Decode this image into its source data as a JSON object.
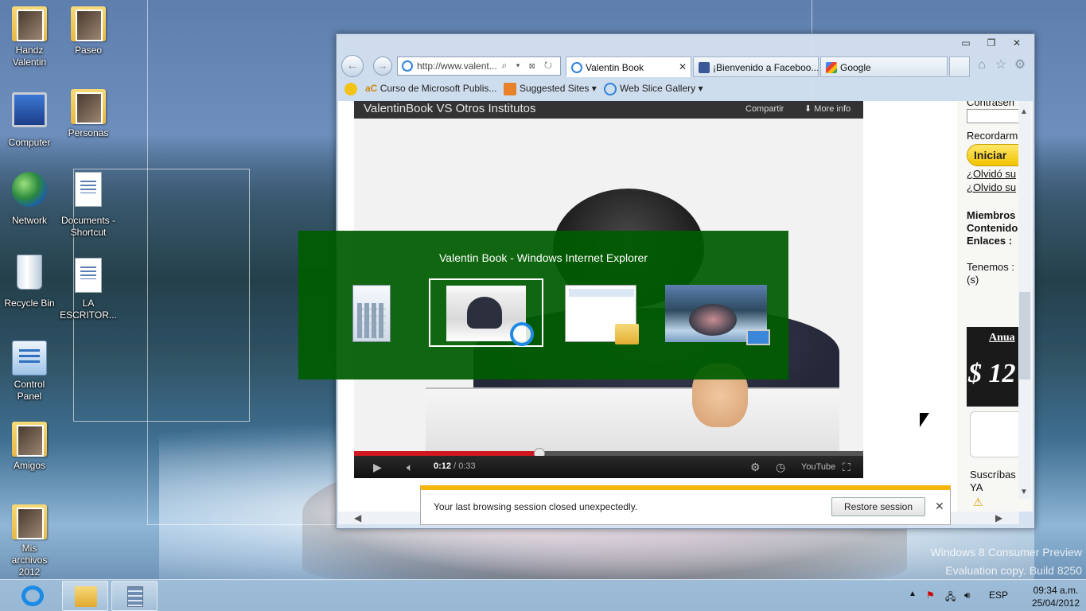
{
  "desktop": {
    "icons": [
      {
        "label": "Handz\nValentin"
      },
      {
        "label": "Paseo"
      },
      {
        "label": "Computer"
      },
      {
        "label": "Personas"
      },
      {
        "label": "Network"
      },
      {
        "label": "Documents - Shortcut"
      },
      {
        "label": "Recycle Bin"
      },
      {
        "label": "LA ESCRITOR..."
      },
      {
        "label": "Control Panel"
      },
      {
        "label": "Amigos"
      },
      {
        "label": "Mis archivos 2012"
      }
    ],
    "watermark_line1": "Windows 8 Consumer Preview",
    "watermark_line2": "Evaluation copy. Build 8250"
  },
  "browser": {
    "caption": {
      "minimize": "▭",
      "restore": "❐",
      "close": "✕"
    },
    "address": "http://www.valent...",
    "address_tools": "⌕ ▾ ⊠ ↻",
    "tabs": [
      {
        "label": "Valentin Book",
        "close": "✕"
      },
      {
        "label": "¡Bienvenido a Faceboo..."
      },
      {
        "label": "Google"
      }
    ],
    "favorites": [
      {
        "label": "Curso de Microsoft Publis..."
      },
      {
        "label": "Suggested Sites ▾"
      },
      {
        "label": "Web Slice Gallery ▾"
      }
    ],
    "fav_prefix": "aC"
  },
  "video": {
    "title": "ValentinBook VS Otros Institutos",
    "share": "Compartir",
    "more_info": "More info",
    "time_current": "0:12",
    "time_total": " / 0:33",
    "progress": 0.3636,
    "youtube": "YouTube"
  },
  "sidebar": {
    "password_label": "Contrasen",
    "remember_label": "Recordarm",
    "login_button": "Iniciar",
    "forgot1": "¿Olvidó su",
    "forgot2": "¿Olvido su",
    "stat1": "Miembros",
    "stat2": "Contenido",
    "stat3": "Enlaces :",
    "have1": "Tenemos :",
    "have2": "(s)",
    "ad_title": "Anua",
    "ad_price": "$ 12",
    "subscribe1": "Suscríbas",
    "subscribe2": "YA"
  },
  "notification": {
    "message": "Your last browsing session closed unexpectedly.",
    "restore_button": "Restore session",
    "close": "✕"
  },
  "switcher": {
    "title": "Valentin Book - Windows Internet Explorer"
  },
  "taskbar": {
    "language": "ESP",
    "time": "09:34 a.m.",
    "date": "25/04/2012"
  }
}
